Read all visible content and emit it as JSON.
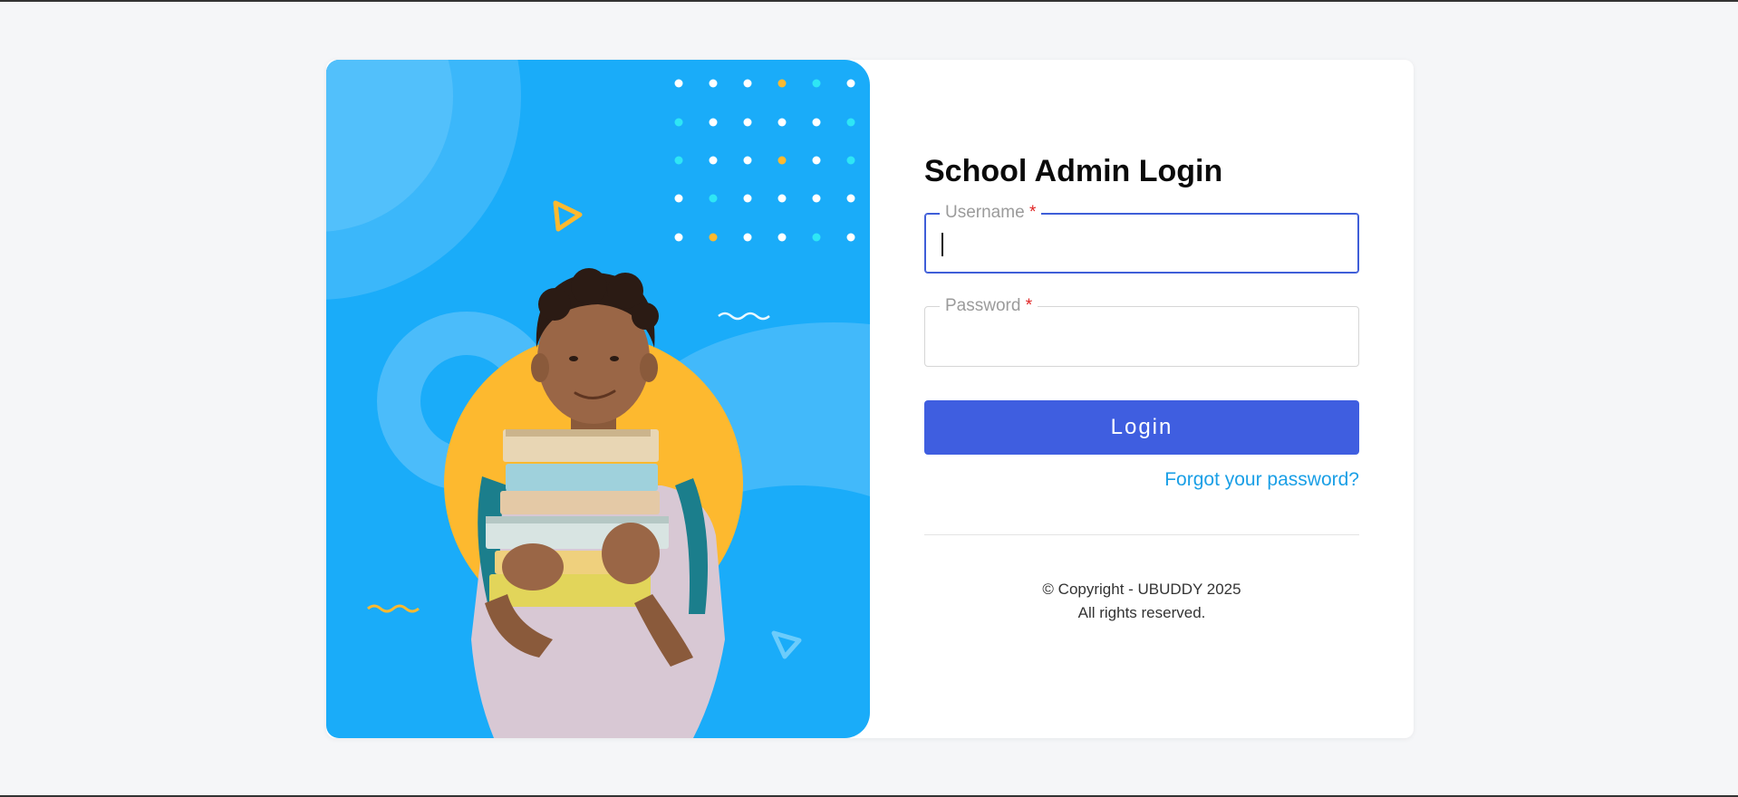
{
  "login": {
    "title": "School Admin Login",
    "username": {
      "label": "Username",
      "required_mark": "*",
      "value": ""
    },
    "password": {
      "label": "Password",
      "required_mark": "*",
      "value": ""
    },
    "login_label": "Login",
    "forgot_label": "Forgot your password?",
    "copyright_line1": "© Copyright - UBUDDY 2025",
    "copyright_line2": "All rights reserved."
  },
  "colors": {
    "page_background": "#f5f6f8",
    "hero_background": "#1aacf9",
    "accent_yellow": "#fdb92f",
    "button": "#3f5ee0",
    "link": "#1a9fe6",
    "required": "#e02424"
  },
  "hero": {
    "illustration": "student-holding-books-image"
  }
}
